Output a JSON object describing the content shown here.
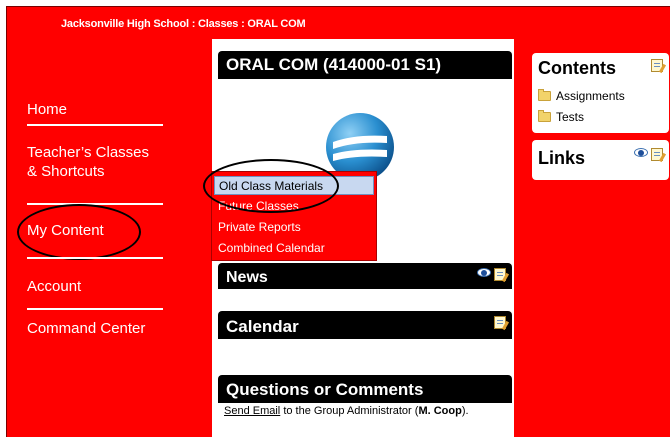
{
  "breadcrumb": "Jacksonville High School : Classes : ORAL COM",
  "nav": {
    "home": "Home",
    "teachers_classes_line1": "Teacher’s Classes",
    "teachers_classes_line2": "& Shortcuts",
    "my_content": "My Content",
    "account": "Account",
    "command_center": "Command Center"
  },
  "class_title": "ORAL COM (414000-01 S1)",
  "dropdown": {
    "items": [
      "Old Class Materials",
      "Future Classes",
      "Private Reports",
      "Combined Calendar"
    ],
    "selected": "Old Class Materials"
  },
  "panels": {
    "news": "News",
    "calendar": "Calendar",
    "questions": "Questions or Comments"
  },
  "footer": {
    "link": "Send Email",
    "text_before": " to the Group Administrator (",
    "admin": "M. Coop",
    "text_after": ")."
  },
  "contents": {
    "title": "Contents",
    "items": [
      "Assignments",
      "Tests"
    ]
  },
  "links": {
    "title": "Links"
  },
  "colors": {
    "background": "#ff0000",
    "panel_header": "#000000",
    "highlight": "#c8d8f0"
  },
  "icons": [
    "eye-icon",
    "edit-icon",
    "folder-icon",
    "class-logo-icon"
  ]
}
